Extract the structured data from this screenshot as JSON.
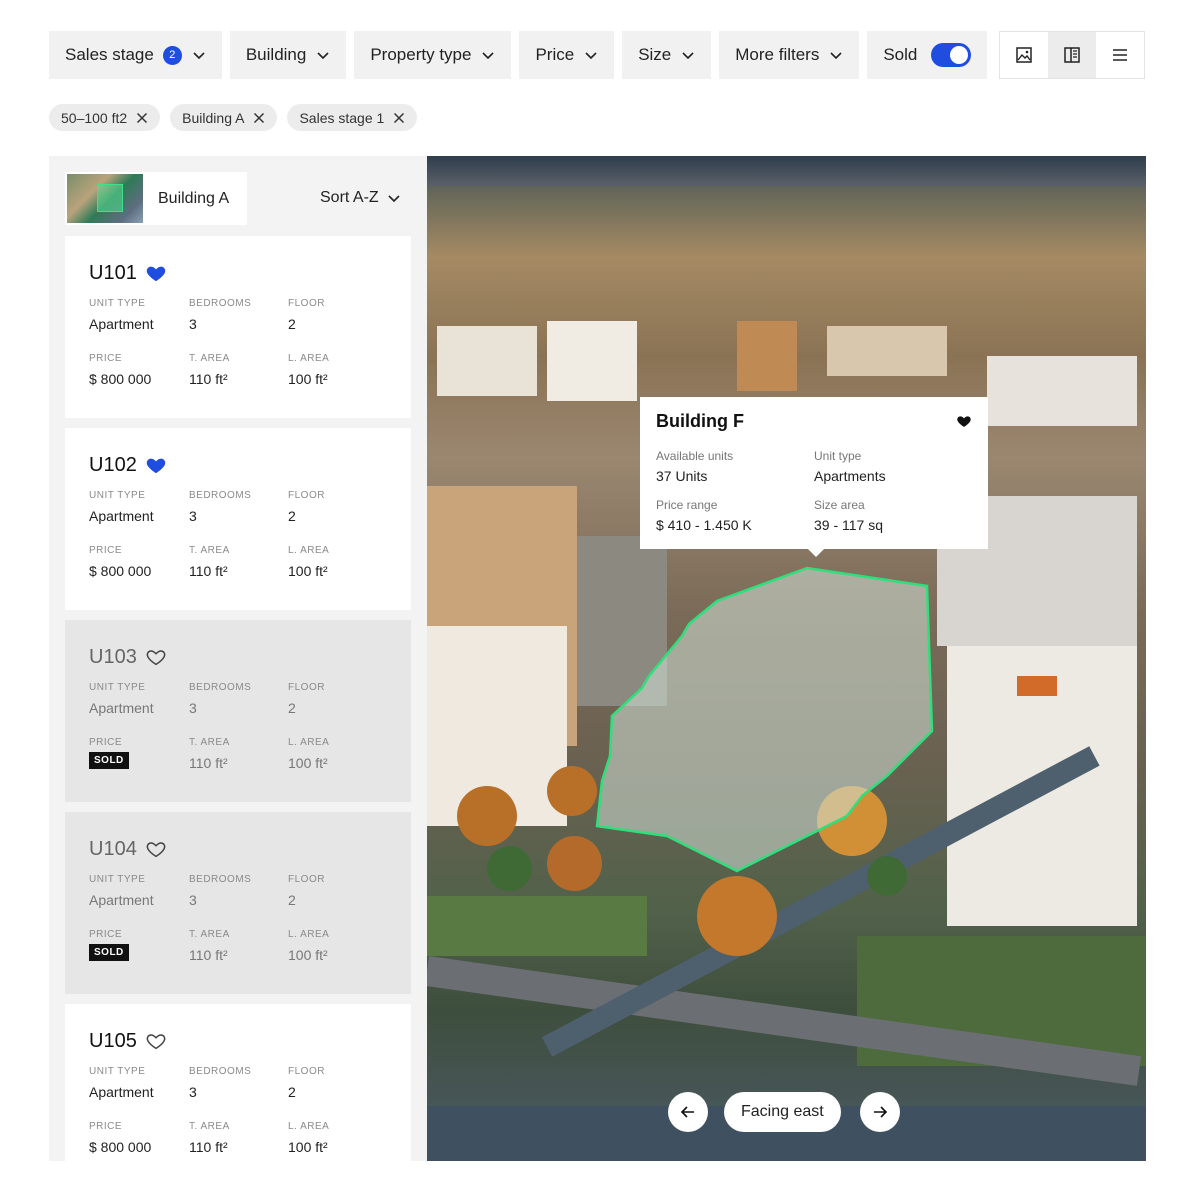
{
  "filters": {
    "sales_stage": {
      "label": "Sales stage",
      "count": "2"
    },
    "building": "Building",
    "property_type": "Property type",
    "price": "Price",
    "size": "Size",
    "more_filters": "More filters",
    "sold": {
      "label": "Sold",
      "on": true
    }
  },
  "view_modes": [
    "image-view",
    "split-view",
    "list-view"
  ],
  "active_view": "split-view",
  "chips": [
    "50–100 ft2",
    "Building A",
    "Sales stage 1"
  ],
  "sidebar": {
    "building": "Building A",
    "sort": "Sort A-Z",
    "labels": {
      "unit_type": "UNIT TYPE",
      "bedrooms": "BEDROOMS",
      "floor": "FLOOR",
      "price": "PRICE",
      "t_area": "T. AREA",
      "l_area": "L. AREA",
      "sold": "SOLD"
    },
    "units": [
      {
        "id": "U101",
        "favorite": true,
        "sold": false,
        "unit_type": "Apartment",
        "bedrooms": "3",
        "floor": "2",
        "price": "$ 800 000",
        "t_area": "110 ft²",
        "l_area": "100 ft²"
      },
      {
        "id": "U102",
        "favorite": true,
        "sold": false,
        "unit_type": "Apartment",
        "bedrooms": "3",
        "floor": "2",
        "price": "$ 800 000",
        "t_area": "110 ft²",
        "l_area": "100 ft²"
      },
      {
        "id": "U103",
        "favorite": false,
        "sold": true,
        "unit_type": "Apartment",
        "bedrooms": "3",
        "floor": "2",
        "price": "",
        "t_area": "110 ft²",
        "l_area": "100 ft²"
      },
      {
        "id": "U104",
        "favorite": false,
        "sold": true,
        "unit_type": "Apartment",
        "bedrooms": "3",
        "floor": "2",
        "price": "",
        "t_area": "110 ft²",
        "l_area": "100 ft²"
      },
      {
        "id": "U105",
        "favorite": false,
        "sold": false,
        "unit_type": "Apartment",
        "bedrooms": "3",
        "floor": "2",
        "price": "$ 800 000",
        "t_area": "110 ft²",
        "l_area": "100 ft²"
      }
    ]
  },
  "popup": {
    "title": "Building F",
    "favorite": true,
    "available_units_label": "Available units",
    "available_units": "37 Units",
    "unit_type_label": "Unit type",
    "unit_type": "Apartments",
    "price_range_label": "Price range",
    "price_range": "$ 410 - 1.450 K",
    "size_area_label": "Size area",
    "size_area": "39 - 117 sq"
  },
  "map_nav": {
    "facing": "Facing east"
  },
  "colors": {
    "accent": "#1f4de0",
    "highlight": "#2ee07c",
    "sold_tag": "#111111"
  }
}
